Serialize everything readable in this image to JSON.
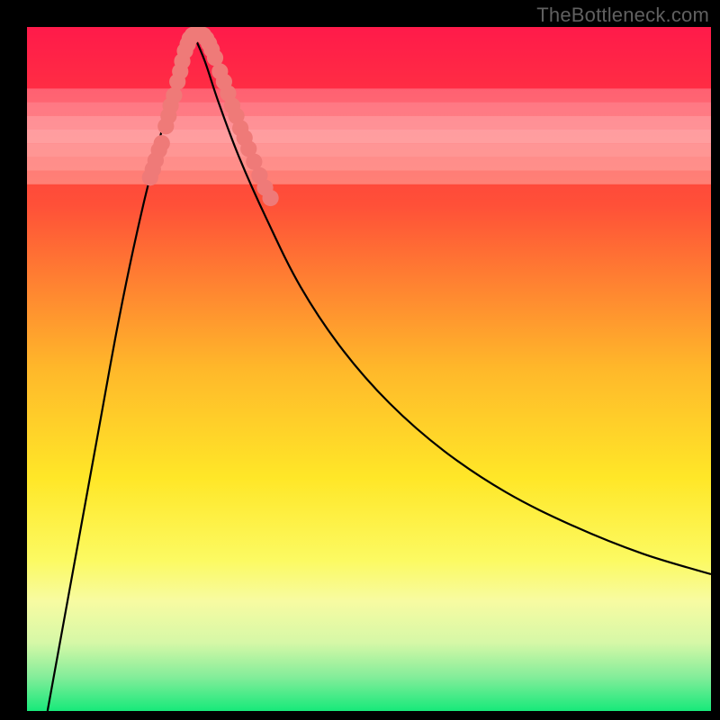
{
  "watermark": "TheBottleneck.com",
  "chart_data": {
    "type": "line",
    "title": "",
    "xlabel": "",
    "ylabel": "",
    "xlim": [
      0,
      100
    ],
    "ylim": [
      0,
      100
    ],
    "grid": false,
    "legend": false,
    "gradient_stops": [
      {
        "pct": 0,
        "color": "#ff1a4a"
      },
      {
        "pct": 26,
        "color": "#ff5038"
      },
      {
        "pct": 50,
        "color": "#ffb82a"
      },
      {
        "pct": 66,
        "color": "#ffe728"
      },
      {
        "pct": 78,
        "color": "#fcfa62"
      },
      {
        "pct": 84,
        "color": "#f7fba2"
      },
      {
        "pct": 90,
        "color": "#d6f8a7"
      },
      {
        "pct": 95,
        "color": "#84ed9a"
      },
      {
        "pct": 100,
        "color": "#17e97a"
      }
    ],
    "bands": [
      {
        "y": 78,
        "color": "rgba(255,255,255,0.30)"
      },
      {
        "y": 80,
        "color": "rgba(255,255,255,0.40)"
      },
      {
        "y": 82,
        "color": "rgba(255,255,255,0.45)"
      },
      {
        "y": 84,
        "color": "rgba(255,255,255,0.50)"
      },
      {
        "y": 86,
        "color": "rgba(255,255,255,0.45)"
      },
      {
        "y": 88,
        "color": "rgba(255,255,255,0.35)"
      },
      {
        "y": 90,
        "color": "rgba(255,255,255,0.25)"
      }
    ],
    "series": [
      {
        "name": "left-curve",
        "x": [
          3,
          5,
          7,
          9,
          11,
          13,
          15,
          17,
          18.5,
          20,
          21.5,
          23,
          24.3
        ],
        "y": [
          0,
          11,
          22,
          33,
          44,
          55,
          65,
          74,
          80,
          86,
          91,
          95.5,
          99
        ]
      },
      {
        "name": "right-curve",
        "x": [
          24.3,
          26,
          28,
          31,
          35,
          40,
          46,
          53,
          61,
          70,
          80,
          90,
          100
        ],
        "y": [
          99,
          95,
          89,
          81,
          72,
          62,
          53,
          45,
          38,
          32,
          27,
          23,
          20
        ]
      }
    ],
    "dot_clusters": {
      "color": "#ef7a78",
      "radius": 1.2,
      "points": [
        [
          18.0,
          78.0
        ],
        [
          18.4,
          79.2
        ],
        [
          18.8,
          80.5
        ],
        [
          19.3,
          82.0
        ],
        [
          19.7,
          83.0
        ],
        [
          20.3,
          85.5
        ],
        [
          20.7,
          87.0
        ],
        [
          21.0,
          88.5
        ],
        [
          21.5,
          90.0
        ],
        [
          22.0,
          92.0
        ],
        [
          22.4,
          93.5
        ],
        [
          22.7,
          95.0
        ],
        [
          23.1,
          96.5
        ],
        [
          23.5,
          97.5
        ],
        [
          23.8,
          98.3
        ],
        [
          24.2,
          98.8
        ],
        [
          24.6,
          99.0
        ],
        [
          25.0,
          99.0
        ],
        [
          25.4,
          99.0
        ],
        [
          25.8,
          98.8
        ],
        [
          26.2,
          98.3
        ],
        [
          26.6,
          97.6
        ],
        [
          27.0,
          96.7
        ],
        [
          27.5,
          95.5
        ],
        [
          28.2,
          93.5
        ],
        [
          28.8,
          92.0
        ],
        [
          29.4,
          90.3
        ],
        [
          30.0,
          88.5
        ],
        [
          30.6,
          87.0
        ],
        [
          31.2,
          85.2
        ],
        [
          31.8,
          83.8
        ],
        [
          32.4,
          82.2
        ],
        [
          33.2,
          80.3
        ],
        [
          34.0,
          78.3
        ],
        [
          34.8,
          76.5
        ],
        [
          35.6,
          75.0
        ]
      ]
    }
  }
}
